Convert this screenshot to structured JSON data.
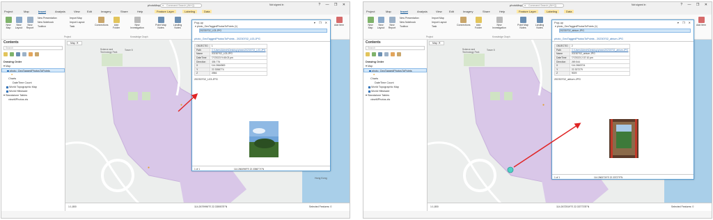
{
  "app": {
    "name": "photoMap",
    "search_placeholder": "Command Search (Alt+Q)",
    "user": "Not signed in",
    "window_buttons": "? — ❐ ✕"
  },
  "ribbon_tabs": [
    "Project",
    "Map",
    "Insert",
    "Analysis",
    "View",
    "Edit",
    "Imagery",
    "Share",
    "Help",
    "Feature Layer",
    "Labeling",
    "Data"
  ],
  "ribbon": {
    "new_map": "New Map",
    "new_layout": "New Layout",
    "new_report": "New Report",
    "new_presentation": "New Presentation",
    "new_notebook": "New Notebook",
    "toolbox": "Toolbox",
    "import_map": "Import Map",
    "import_layout": "Import Layout",
    "task": "Task",
    "connections": "Connections",
    "add_folder": "Add Folder",
    "new_investigation": "New Investigation",
    "point_map_notes": "Point Map Notes",
    "landing_notes": "Landing Notes",
    "add_item": "Add Item",
    "group_project": "Project",
    "group_knowledge": "Knowledge Graph",
    "group_layer_template": "Layer Templates"
  },
  "contents": {
    "title": "Contents",
    "search_placeholder": "Search",
    "drawing_order": "Drawing Order",
    "items": {
      "map": "Map",
      "layer": "photo_GeoTaggedPhotosToPoints",
      "charts": "Charts",
      "chart": "DateTime Count",
      "topo": "World Topographic Map",
      "hillshade": "World Hillshade",
      "standalone": "Standalone Tables",
      "table": "viewMPhotos.xls"
    }
  },
  "map_tab": "Map",
  "map_labels": {
    "science_park": "Science and Technology Park",
    "tower": "Tower 5"
  },
  "status_left": {
    "scale": "1:1,800",
    "coords": "114.2679996°E 22.3359375°N",
    "selected": "Selected Features: 0"
  },
  "status_right": {
    "scale": "1:1,800",
    "coords": "114.2672519°E 22.3377378°N",
    "selected": "Selected Features: 0"
  },
  "popup_left": {
    "title": "Pop-up",
    "tree_layer": "photo_GeoTaggedPhotosToPoints (1)",
    "tree_item": "20230702_L03.JPG",
    "header": "photo_GeoTaggedPhotosToPoints - 20230702_L03.JPG",
    "rows": [
      {
        "k": "OBJECTID",
        "v": "1"
      },
      {
        "k": "Path",
        "v": "C:\\Users\\Admin\\Desktop\\photo\\20230702_L03.JPG"
      },
      {
        "k": "Name",
        "v": "20230702_L03.JPG"
      },
      {
        "k": "DateTime",
        "v": "7/7/2023 9:45:03 pm"
      },
      {
        "k": "Direction",
        "v": "335.776"
      },
      {
        "k": "X",
        "v": "114.2664969"
      },
      {
        "k": "Y",
        "v": "22.3358774"
      },
      {
        "k": "Z",
        "v": "4966"
      }
    ],
    "caption": "20230702_L03.JPG",
    "footer_left": "1 of 1",
    "footer_coords": "114.2664969°E 22.3358774°N"
  },
  "popup_right": {
    "title": "Pop-up",
    "tree_layer": "photo_GeoTaggedPhotosToPoints (1)",
    "tree_item": "20230702_atrium.JPG",
    "header": "photo_GeoTaggedPhotosToPoints - 20230702_atrium.JPG",
    "rows": [
      {
        "k": "OBJECTID",
        "v": "2"
      },
      {
        "k": "Path",
        "v": "C:\\Users\\Admin\\Desktop\\photo\\20230702_atrium.JPG"
      },
      {
        "k": "Name",
        "v": "20230702_atrium.JPG"
      },
      {
        "k": "DateTime",
        "v": "7/7/2023 2:37:10 pm"
      },
      {
        "k": "Direction",
        "v": "269.544"
      },
      {
        "k": "X",
        "v": "114.2663724"
      },
      {
        "k": "Y",
        "v": "22.337279"
      },
      {
        "k": "Z",
        "v": "9009"
      }
    ],
    "caption": "20230702_atrium.JPG",
    "footer_left": "1 of 1",
    "footer_coords": "114.2663724°E 22.337279°N"
  },
  "colors": {
    "accent": "#0b5394",
    "arrow": "#e02424",
    "building": "#d9c7e8",
    "green": "#cfe3c3",
    "water": "#a9cfe9"
  }
}
